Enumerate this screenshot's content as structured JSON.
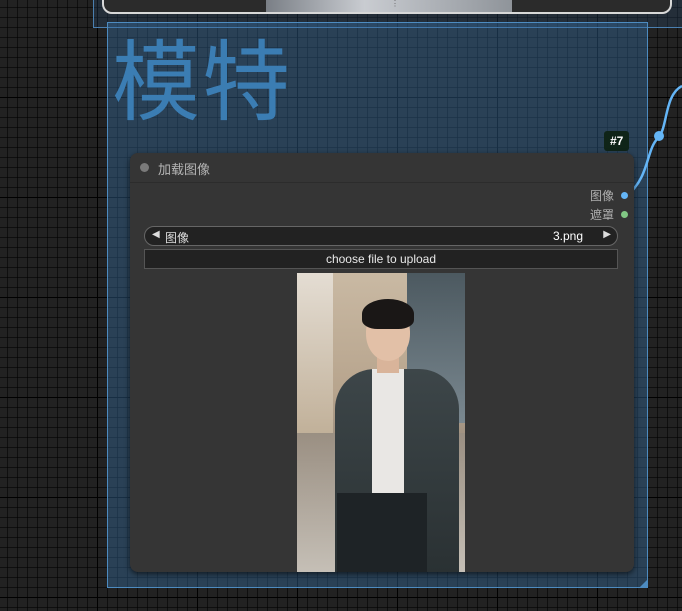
{
  "group": {
    "title": "模特"
  },
  "node": {
    "id_badge": "#7",
    "title": "加载图像",
    "outputs": [
      {
        "label": "图像",
        "color": "#64b5f6"
      },
      {
        "label": "遮罩",
        "color": "#81c784"
      }
    ],
    "image_widget": {
      "label": "图像",
      "value": "3.png"
    },
    "upload_label": "choose file to upload",
    "preview_alt": "preview image"
  },
  "colors": {
    "canvas_bg": "#222222",
    "group_fill": "#386ea0",
    "group_title": "#3b7db3",
    "node_bg": "#353535",
    "link_color": "#64b5f6"
  }
}
